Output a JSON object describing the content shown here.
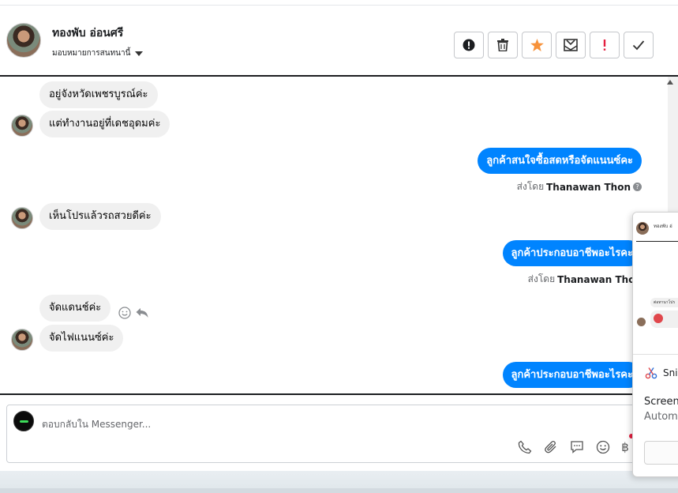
{
  "header": {
    "contact_name": "ทองพับ อ่อนศรี",
    "assign_label": "มอบหมายการสนทนานี้"
  },
  "toolbar": {
    "buttons": [
      "info-icon",
      "trash-icon",
      "star-icon",
      "mail-icon",
      "exclamation-icon",
      "check-icon"
    ],
    "star_color": "#f7923a",
    "alert_color": "#e41e3f"
  },
  "messages": [
    {
      "side": "in",
      "text": "อยู่จังหวัดเพชรบูรณ์ค่ะ"
    },
    {
      "side": "in",
      "text": "แต่ทำงานอยู่ที่เดชอุดมค่ะ"
    },
    {
      "side": "out",
      "text": "ลูกค้าสนใจซื้อสดหรือจัดแนนซ์คะ"
    },
    {
      "side": "in",
      "text": "เห็นโปรแล้วรถสวยดีค่ะ"
    },
    {
      "side": "out",
      "text": "ลูกค้าประกอบอาชีพอะไรคะ"
    },
    {
      "side": "in",
      "text": "จัดแดนช์ค่ะ"
    },
    {
      "side": "in",
      "text": "จัดไฟแนนซ์ค่ะ"
    },
    {
      "side": "out",
      "text": "ลูกค้าประกอบอาชีพอะไรคะ"
    }
  ],
  "sent_by": {
    "prefix": "ส่งโดย",
    "name": "Thanawan Thon"
  },
  "composer": {
    "placeholder": "ตอบกลับใน Messenger...",
    "icons": [
      "phone-icon",
      "paperclip-icon",
      "saved-reply-icon",
      "emoji-icon",
      "baht-icon"
    ],
    "currency_symbol": "฿"
  },
  "snip_popup": {
    "thumb_name": "ทองพับ อ่",
    "thumb_pill": "ต่อทานาโปร",
    "app_name": "Snip",
    "title": "Screens",
    "subtitle": "Autom"
  },
  "brand_color": "#0084ff"
}
